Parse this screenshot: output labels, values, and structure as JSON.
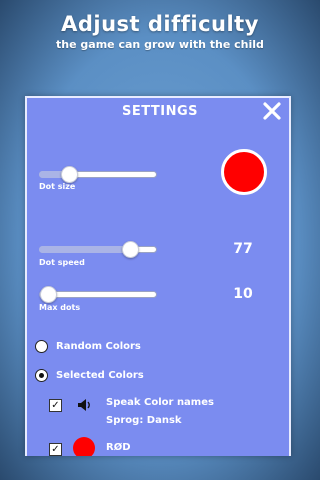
{
  "header": {
    "title": "Adjust difficulty",
    "subtitle": "the game can grow with the child"
  },
  "settings": {
    "title": "SETTINGS",
    "close_icon": "close-icon",
    "dot_size": {
      "label": "Dot size",
      "level": 0.25,
      "preview_color": "#ff0000"
    },
    "dot_speed": {
      "label": "Dot speed",
      "level": 0.77,
      "value": "77"
    },
    "max_dots": {
      "label": "Max dots",
      "level": 0.08,
      "value": "10"
    },
    "color_mode": {
      "options": [
        {
          "label": "Random Colors",
          "selected": false
        },
        {
          "label": "Selected Colors",
          "selected": true
        }
      ]
    },
    "speak_colors": {
      "checked": true,
      "label": "Speak Color names",
      "language": "Sprog: Dansk",
      "icon": "speaker-icon"
    },
    "colors": [
      {
        "name": "RØD",
        "color": "#ff0000",
        "checked": true
      }
    ]
  },
  "colors": {
    "panel": "#7b8cf0",
    "accent_red": "#ff0000",
    "background": "#6fa3d6"
  }
}
